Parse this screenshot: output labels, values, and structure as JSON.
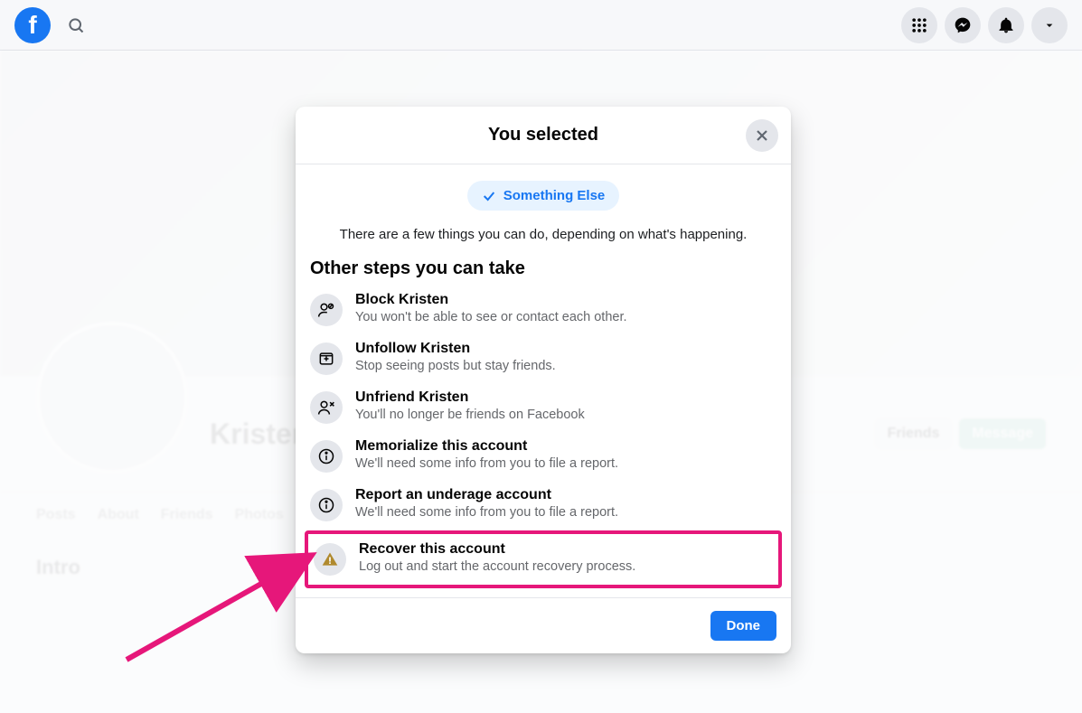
{
  "header": {
    "logo_letter": "f"
  },
  "background": {
    "profile_name": "Kristen",
    "intro_label": "Intro"
  },
  "modal": {
    "title": "You selected",
    "pill_label": "Something Else",
    "instruction": "There are a few things you can do, depending on what's happening.",
    "section_title": "Other steps you can take",
    "steps": [
      {
        "title": "Block Kristen",
        "desc": "You won't be able to see or contact each other."
      },
      {
        "title": "Unfollow Kristen",
        "desc": "Stop seeing posts but stay friends."
      },
      {
        "title": "Unfriend Kristen",
        "desc": "You'll no longer be friends on Facebook"
      },
      {
        "title": "Memorialize this account",
        "desc": "We'll need some info from you to file a report."
      },
      {
        "title": "Report an underage account",
        "desc": "We'll need some info from you to file a report."
      },
      {
        "title": "Recover this account",
        "desc": "Log out and start the account recovery process."
      }
    ],
    "done_label": "Done"
  }
}
